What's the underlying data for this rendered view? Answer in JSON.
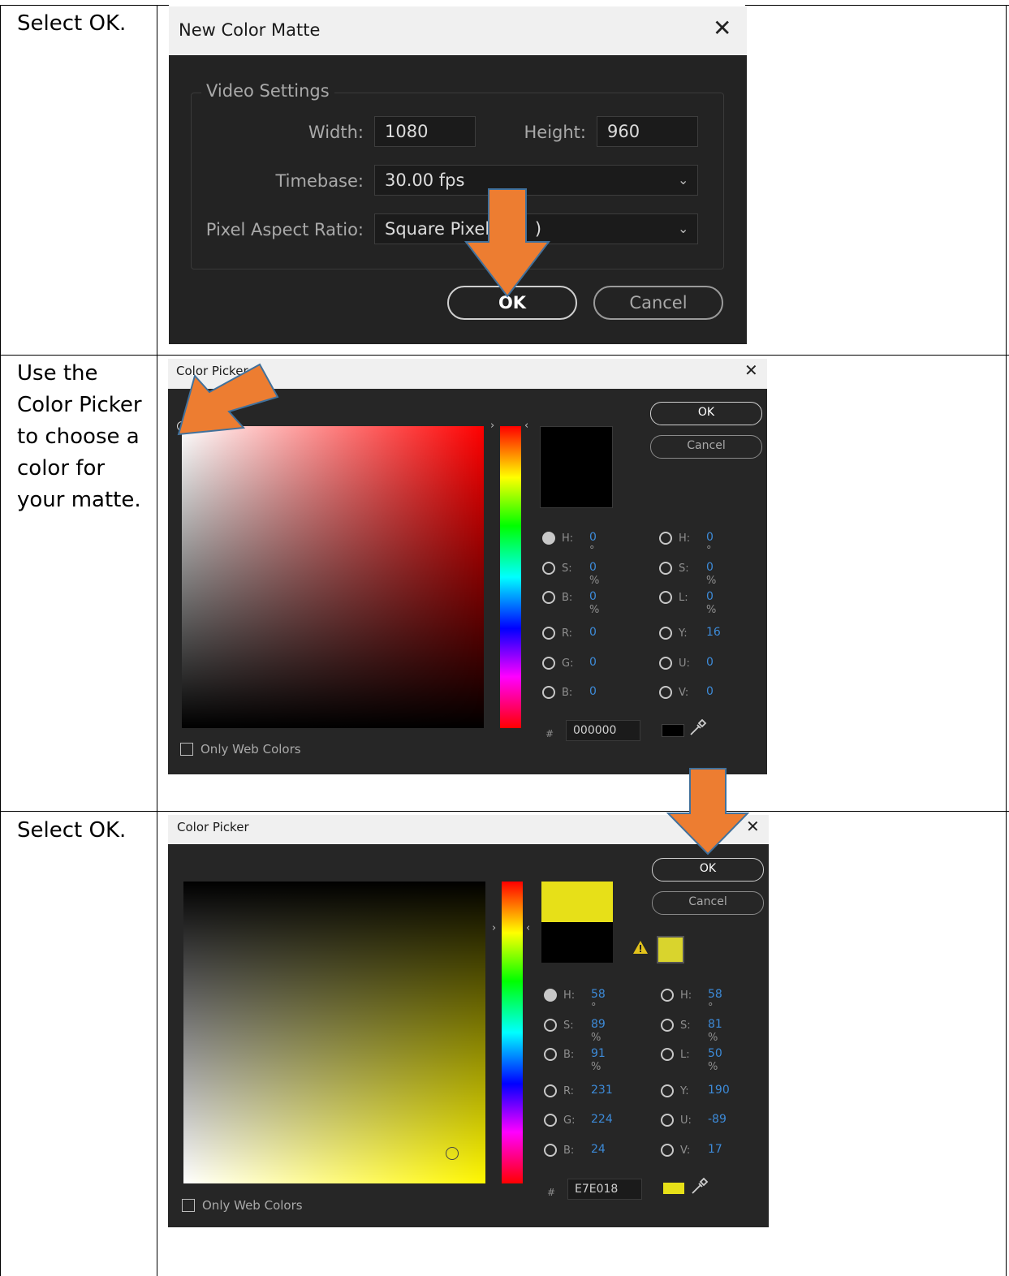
{
  "steps": [
    {
      "instruction": "Select OK."
    },
    {
      "instruction": "Use the Color Picker to choose a color for your matte."
    },
    {
      "instruction": "Select OK."
    }
  ],
  "matte_dialog": {
    "title": "New Color Matte",
    "group_label": "Video Settings",
    "width_label": "Width:",
    "width_value": "1080",
    "height_label": "Height:",
    "height_value": "960",
    "timebase_label": "Timebase:",
    "timebase_value": "30.00 fps",
    "par_label": "Pixel Aspect Ratio:",
    "par_value": "Square Pixels",
    "par_value_tail": ")",
    "ok_label": "OK",
    "cancel_label": "Cancel"
  },
  "picker_black": {
    "title": "Color Picker",
    "ok_label": "OK",
    "cancel_label": "Cancel",
    "hsb": {
      "h": "0",
      "s": "0",
      "b": "0"
    },
    "hsl": {
      "h": "0",
      "s": "0",
      "l": "0"
    },
    "rgb": {
      "r": "0",
      "g": "0",
      "b": "0"
    },
    "yuv": {
      "y": "16",
      "u": "0",
      "v": "0"
    },
    "hex_symbol": "#",
    "hex": "000000",
    "only_web_colors": "Only Web Colors",
    "current_color": "#000000"
  },
  "picker_yellow": {
    "title": "Color Picker",
    "ok_label": "OK",
    "cancel_label": "Cancel",
    "hsb": {
      "h": "58",
      "s": "89",
      "b": "91"
    },
    "hsl": {
      "h": "58",
      "s": "81",
      "l": "50"
    },
    "rgb": {
      "r": "231",
      "g": "224",
      "b": "24"
    },
    "yuv": {
      "y": "190",
      "u": "-89",
      "v": "17"
    },
    "hex_symbol": "#",
    "hex": "E7E018",
    "only_web_colors": "Only Web Colors",
    "new_color": "#e7e018",
    "old_color": "#000000",
    "websafe_color": "#d9d42d",
    "warning_icon": "warning-triangle-icon"
  },
  "labels": {
    "h": "H:",
    "s": "S:",
    "b": "B:",
    "l": "L:",
    "r": "R:",
    "g": "G:",
    "y": "Y:",
    "u": "U:",
    "v": "V:",
    "deg": "°",
    "pct": "%"
  },
  "colors": {
    "callout_arrow": "#ed7d31",
    "callout_arrow_outline": "#41719c",
    "value_blue": "#3d8bd9"
  }
}
